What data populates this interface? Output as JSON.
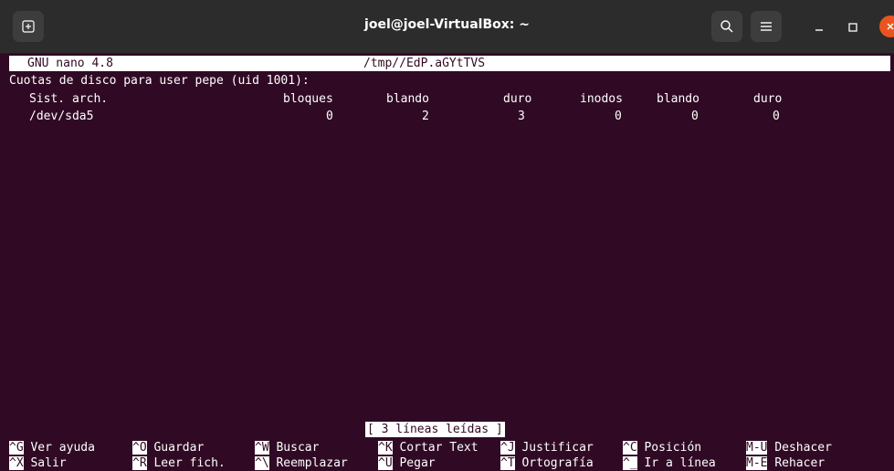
{
  "window": {
    "title": "joel@joel-VirtualBox: ~"
  },
  "icons": [
    "new-tab-icon",
    "search-icon",
    "menu-icon",
    "minimize-icon",
    "maximize-icon",
    "close-icon"
  ],
  "nano": {
    "version": "GNU nano 4.8",
    "file": "/tmp//EdP.aGYtTVS",
    "quota_title": "Cuotas de disco para user pepe (uid 1001):",
    "columns": [
      "Sist. arch.",
      "bloques",
      "blando",
      "duro",
      "inodos",
      "blando",
      "duro"
    ],
    "row": [
      "/dev/sda5",
      "0",
      "2",
      "3",
      "0",
      "0",
      "0"
    ],
    "status_message": "[ 3 líneas leídas ]"
  },
  "shortcuts_row1": [
    {
      "key": "^G",
      "label": "Ver ayuda"
    },
    {
      "key": "^O",
      "label": "Guardar"
    },
    {
      "key": "^W",
      "label": "Buscar"
    },
    {
      "key": "^K",
      "label": "Cortar Text"
    },
    {
      "key": "^J",
      "label": "Justificar"
    },
    {
      "key": "^C",
      "label": "Posición"
    },
    {
      "key": "M-U",
      "label": "Deshacer"
    }
  ],
  "shortcuts_row2": [
    {
      "key": "^X",
      "label": "Salir"
    },
    {
      "key": "^R",
      "label": "Leer fich."
    },
    {
      "key": "^\\",
      "label": "Reemplazar"
    },
    {
      "key": "^U",
      "label": "Pegar"
    },
    {
      "key": "^T",
      "label": "Ortografía"
    },
    {
      "key": "^_",
      "label": "Ir a línea"
    },
    {
      "key": "M-E",
      "label": "Rehacer"
    }
  ],
  "colors": {
    "terminal_bg": "#300a24",
    "titlebar_bg": "#2c2c2c",
    "close_button": "#e95420",
    "text": "#ffffff"
  }
}
